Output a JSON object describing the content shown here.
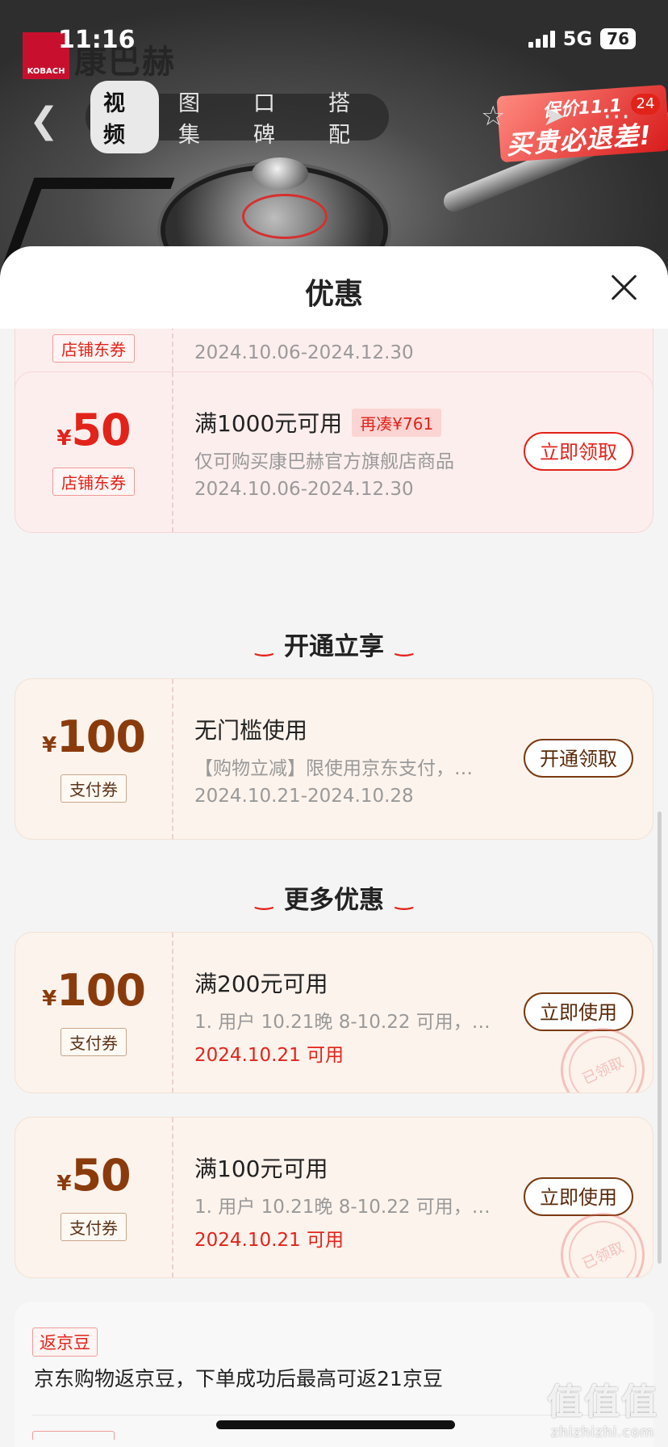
{
  "status": {
    "time": "11:16",
    "network": "5G",
    "battery": "76"
  },
  "brand": {
    "logo_text": "KOBACH",
    "name": "康巴赫"
  },
  "nav": {
    "tabs": [
      {
        "label": "视频",
        "active": true
      },
      {
        "label": "图集",
        "active": false
      },
      {
        "label": "口碑",
        "active": false
      },
      {
        "label": "搭配",
        "active": false
      }
    ],
    "icons": [
      "back-icon",
      "star-icon",
      "share-icon",
      "more-icon"
    ],
    "badge": "24",
    "promo_line1": "保价11.1",
    "promo_line2": "买贵必退差!"
  },
  "sheet": {
    "title": "优惠",
    "close_icon": "close-icon"
  },
  "coupons": [
    {
      "style": "red",
      "yen": "¥",
      "amount": "",
      "type": "店铺东券",
      "title": "",
      "desc": "",
      "date": "2024.10.06-2024.12.30",
      "button": ""
    },
    {
      "style": "red",
      "yen": "¥",
      "amount": "50",
      "type": "店铺东券",
      "title": "满1000元可用",
      "need": "再凑¥761",
      "desc": "仅可购买康巴赫官方旗舰店商品",
      "date": "2024.10.06-2024.12.30",
      "button": "立即领取"
    }
  ],
  "section_open": {
    "title": "开通立享"
  },
  "open_coupons": [
    {
      "style": "gold",
      "yen": "¥",
      "amount": "100",
      "type": "支付券",
      "title": "无门槛使用",
      "desc": "【购物立减】限使用京东支付，…",
      "date": "2024.10.21-2024.10.28",
      "button": "开通领取"
    }
  ],
  "section_more": {
    "title": "更多优惠"
  },
  "more_coupons": [
    {
      "style": "gold",
      "yen": "¥",
      "amount": "100",
      "type": "支付券",
      "title": "满200元可用",
      "desc": "1. 用户 10.21晚 8-10.22 可用，…",
      "date": "2024.10.21 可用",
      "button": "立即使用",
      "stamp": "已领取"
    },
    {
      "style": "gold",
      "yen": "¥",
      "amount": "50",
      "type": "支付券",
      "title": "满100元可用",
      "desc": "1. 用户 10.21晚 8-10.22 可用，…",
      "date": "2024.10.21 可用",
      "button": "立即使用",
      "stamp": "已领取"
    }
  ],
  "beans": {
    "tag": "返京豆",
    "text": "京东购物返京豆，下单成功后最高可返21京豆"
  },
  "watermark": {
    "main": "值值值",
    "sub": "zhizhizhi.com"
  },
  "colors": {
    "accent_red": "#e2231a",
    "gold_text": "#8a3b0c"
  }
}
